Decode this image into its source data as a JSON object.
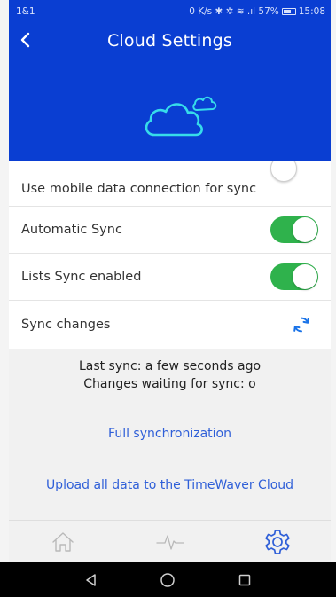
{
  "statusbar": {
    "carrier": "1&1",
    "indicators": "0 K/s ✱ ✲ ≋ .ıl 57%",
    "time": "15:08"
  },
  "header": {
    "title": "Cloud Settings",
    "back_icon": "chevron-left-icon",
    "hero_icon": "cloud-icon"
  },
  "settings": {
    "mobile_data_label": "Use mobile data connection for sync",
    "mobile_data_enabled": false,
    "automatic_sync_label": "Automatic Sync",
    "automatic_sync_enabled": true,
    "lists_sync_label": "Lists Sync enabled",
    "lists_sync_enabled": true,
    "sync_changes_label": "Sync changes"
  },
  "sync_info": {
    "last_sync": "Last sync: a few seconds ago",
    "changes_waiting": "Changes waiting for sync: o"
  },
  "actions": {
    "full_sync": "Full synchronization",
    "upload_all": "Upload all data to the TimeWaver Cloud"
  },
  "bottom_nav": {
    "items": [
      "home-icon",
      "pulse-icon",
      "gear-icon"
    ],
    "active": "gear-icon"
  },
  "colors": {
    "header_bg": "#0a3ed2",
    "toggle_on": "#2fb24c",
    "link": "#2f5fd8",
    "accent_icon": "#1a73e8"
  }
}
